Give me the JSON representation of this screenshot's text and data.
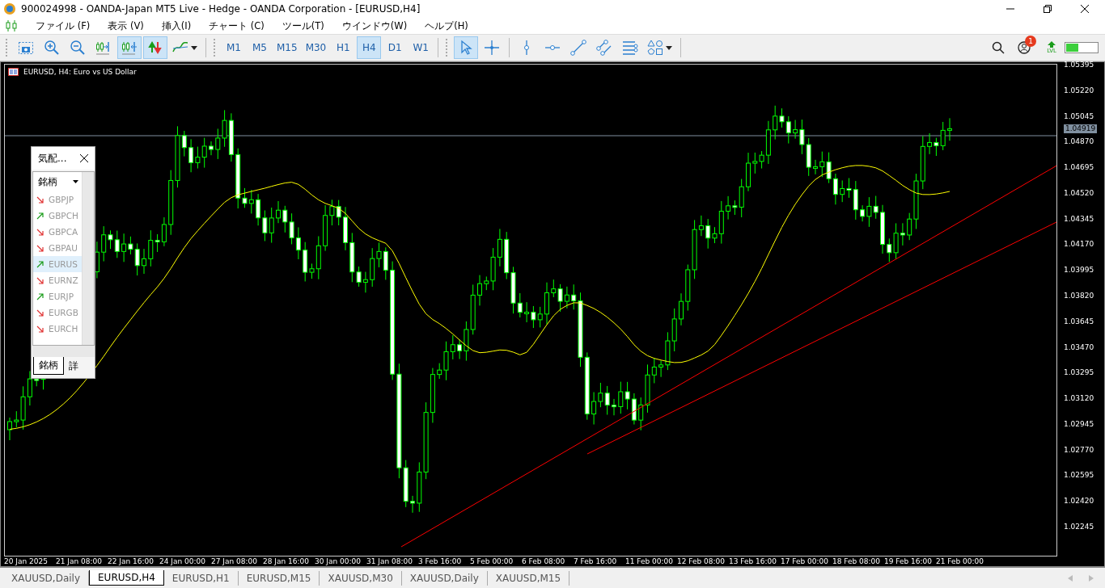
{
  "window": {
    "title": "900024998 - OANDA-Japan MT5 Live - Hedge - OANDA Corporation - [EURUSD,H4]"
  },
  "menu": [
    "ファイル (F)",
    "表示 (V)",
    "挿入(I)",
    "チャート (C)",
    "ツール(T)",
    "ウインドウ(W)",
    "ヘルプ(H)"
  ],
  "toolbar": {
    "tools": [
      {
        "kind": "screenshot",
        "selected": false
      },
      {
        "kind": "zoom-in",
        "selected": false
      },
      {
        "kind": "zoom-out",
        "selected": false
      },
      {
        "kind": "chart-shift",
        "selected": false
      },
      {
        "kind": "autoscroll",
        "selected": true
      },
      {
        "kind": "trade",
        "selected": true
      },
      {
        "kind": "indicators",
        "selected": false
      }
    ],
    "timeframes": [
      {
        "label": "M1",
        "selected": false
      },
      {
        "label": "M5",
        "selected": false
      },
      {
        "label": "M15",
        "selected": false
      },
      {
        "label": "M30",
        "selected": false
      },
      {
        "label": "H1",
        "selected": false
      },
      {
        "label": "H4",
        "selected": true
      },
      {
        "label": "D1",
        "selected": false
      },
      {
        "label": "W1",
        "selected": false
      }
    ],
    "objects": [
      {
        "kind": "cursor",
        "selected": true
      },
      {
        "kind": "crosshair",
        "selected": false
      },
      {
        "kind": "vertical-line",
        "selected": false
      },
      {
        "kind": "horizontal-line",
        "selected": false
      },
      {
        "kind": "trendline",
        "selected": false
      },
      {
        "kind": "channel",
        "selected": false
      },
      {
        "kind": "fibonacci",
        "selected": false
      },
      {
        "kind": "shapes",
        "selected": false
      }
    ],
    "notification_count": "1",
    "level_label": "LVL"
  },
  "chart": {
    "title": "EURUSD, H4:  Euro vs US Dollar",
    "price_labels": [
      "1.05395",
      "1.05220",
      "1.05045",
      "1.04870",
      "1.04695",
      "1.04520",
      "1.04345",
      "1.04170",
      "1.03995",
      "1.03820",
      "1.03645",
      "1.03470",
      "1.03295",
      "1.03120",
      "1.02945",
      "1.02770",
      "1.02595",
      "1.02420",
      "1.02245"
    ],
    "current_price": "1.04919",
    "time_labels": [
      "20 Jan 2025",
      "21 Jan 08:00",
      "22 Jan 16:00",
      "24 Jan 00:00",
      "27 Jan 08:00",
      "28 Jan 16:00",
      "30 Jan 00:00",
      "31 Jan 08:00",
      "3 Feb 16:00",
      "5 Feb 00:00",
      "6 Feb 08:00",
      "7 Feb 16:00",
      "11 Feb 00:00",
      "12 Feb 08:00",
      "13 Feb 16:00",
      "17 Feb 00:00",
      "18 Feb 08:00",
      "19 Feb 16:00",
      "21 Feb 00:00"
    ]
  },
  "market_watch": {
    "title": "気配...",
    "column": "銘柄",
    "symbols": [
      {
        "name": "GBPJP",
        "kind": "down",
        "selected": false
      },
      {
        "name": "GBPCH",
        "kind": "up",
        "selected": false
      },
      {
        "name": "GBPCA",
        "kind": "down",
        "selected": false
      },
      {
        "name": "GBPAU",
        "kind": "down",
        "selected": false
      },
      {
        "name": "EURUS",
        "kind": "up",
        "selected": true
      },
      {
        "name": "EURNZ",
        "kind": "down",
        "selected": false
      },
      {
        "name": "EURJP",
        "kind": "up",
        "selected": false
      },
      {
        "name": "EURGB",
        "kind": "down",
        "selected": false
      },
      {
        "name": "EURCH",
        "kind": "down",
        "selected": false
      }
    ],
    "tabs": [
      {
        "label": "銘柄",
        "selected": true
      },
      {
        "label": "詳",
        "selected": false
      }
    ]
  },
  "chart_tabs": [
    {
      "label": "XAUUSD,Daily",
      "selected": false
    },
    {
      "label": "EURUSD,H4",
      "selected": true
    },
    {
      "label": "EURUSD,H1",
      "selected": false
    },
    {
      "label": "EURUSD,M15",
      "selected": false
    },
    {
      "label": "XAUUSD,M30",
      "selected": false
    },
    {
      "label": "XAUUSD,Daily",
      "selected": false
    },
    {
      "label": "XAUUSD,M15",
      "selected": false
    }
  ]
}
